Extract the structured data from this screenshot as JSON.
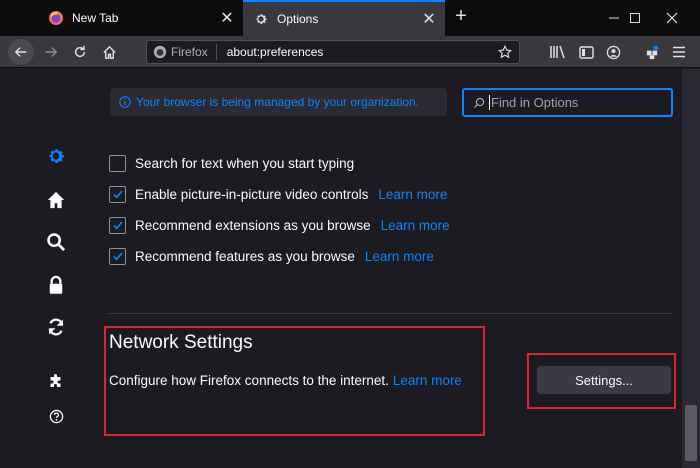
{
  "tabs": [
    {
      "label": "New Tab",
      "icon": "firefox-icon",
      "active": false
    },
    {
      "label": "Options",
      "icon": "gear-icon",
      "active": true
    }
  ],
  "urlbar": {
    "identity": "Firefox",
    "url": "about:preferences"
  },
  "managed_notice": "Your browser is being managed by your organization.",
  "search": {
    "placeholder": "Find in Options"
  },
  "categories": [
    "gear-icon",
    "home-icon",
    "search-icon",
    "lock-icon",
    "sync-icon",
    "puzzle-icon",
    "help-icon"
  ],
  "prefs": [
    {
      "label": "Search for text when you start typing",
      "checked": false,
      "learn_more": ""
    },
    {
      "label": "Enable picture-in-picture video controls",
      "checked": true,
      "learn_more": "Learn more"
    },
    {
      "label": "Recommend extensions as you browse",
      "checked": true,
      "learn_more": "Learn more"
    },
    {
      "label": "Recommend features as you browse",
      "checked": true,
      "learn_more": "Learn more"
    }
  ],
  "network": {
    "title": "Network Settings",
    "description": "Configure how Firefox connects to the internet.",
    "learn_more": "Learn more",
    "settings_button": "Settings..."
  },
  "colors": {
    "accent": "#0a84ff",
    "highlight_box": "#e0212f",
    "background": "#1c1b22"
  }
}
